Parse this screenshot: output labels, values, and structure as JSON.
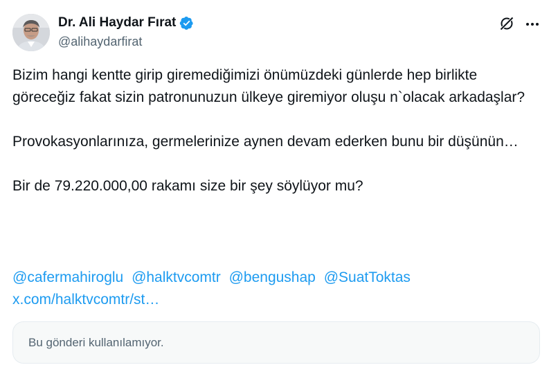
{
  "author": {
    "display_name": "Dr. Ali Haydar Fırat",
    "handle": "@alihaydarfirat",
    "verified": true
  },
  "icons": {
    "verified": "verified-badge-icon",
    "grok": "grok-icon",
    "more": "more-options-icon"
  },
  "tweet": {
    "paragraphs": [
      "Bizim hangi kentte girip giremediğimizi önümüzdeki günlerde hep birlikte göreceğiz fakat sizin patronunuzun ülkeye giremiyor oluşu n`olacak arkadaşlar?",
      "Provokasyonlarınıza, germelerinize aynen devam ederken bunu bir düşünün…",
      "Bir de 79.220.000,00 rakamı size bir şey söylüyor mu?"
    ],
    "mentions": [
      "@cafermahiroglu",
      "@halktvcomtr",
      "@bengushap",
      "@SuatToktas"
    ],
    "link": "x.com/halktvcomtr/st…"
  },
  "quoted_post": {
    "unavailable_text": "Bu gönderi kullanılamıyor."
  },
  "colors": {
    "link": "#1d9bf0",
    "verified": "#1d9bf0",
    "secondary_text": "#536471",
    "quote_bg": "#f7f9f9"
  }
}
